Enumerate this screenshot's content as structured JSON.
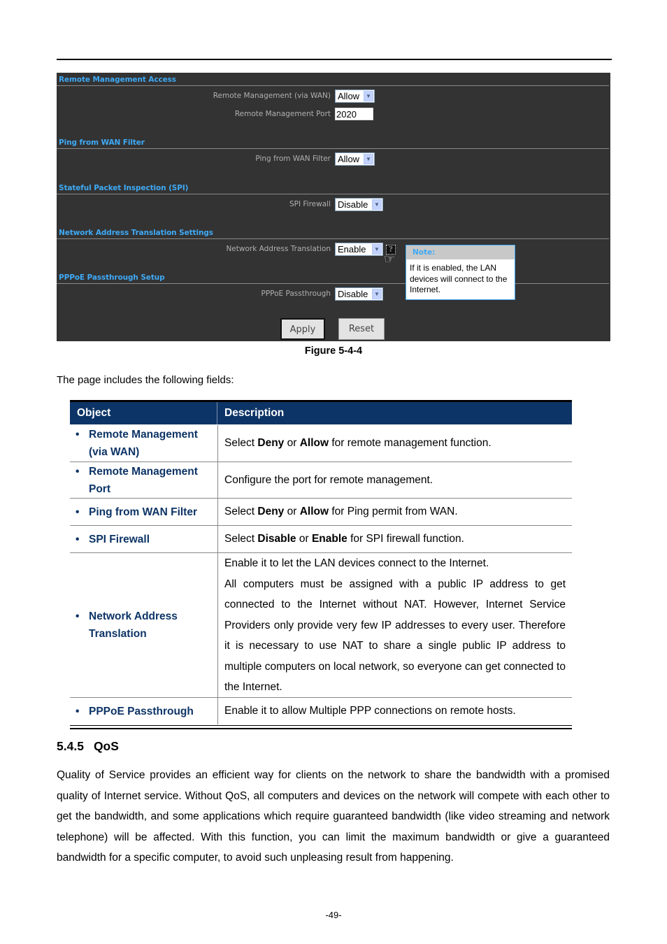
{
  "figure": {
    "sections": [
      {
        "title": "Remote Management Access"
      },
      {
        "title": "Ping from WAN Filter"
      },
      {
        "title": "Stateful Packet Inspection (SPI)"
      },
      {
        "title": "Network Address Translation Settings"
      },
      {
        "title": "PPPoE Passthrough Setup"
      }
    ],
    "fields": {
      "remote_mgmt": {
        "label": "Remote Management (via WAN)",
        "value": "Allow"
      },
      "remote_port": {
        "label": "Remote Management Port",
        "value": "2020"
      },
      "ping_filter": {
        "label": "Ping from WAN Filter",
        "value": "Allow"
      },
      "spi": {
        "label": "SPI Firewall",
        "value": "Disable"
      },
      "nat": {
        "label": "Network Address Translation",
        "value": "Enable"
      },
      "pppoe": {
        "label": "PPPoE Passthrough",
        "value": "Disable"
      }
    },
    "help_icon": "?",
    "note": {
      "title": "Note:",
      "body": "If it is enabled, the LAN devices will connect to the Internet."
    },
    "buttons": {
      "apply": "Apply",
      "reset": "Reset"
    },
    "caption": "Figure 5-4-4"
  },
  "intro": "The page includes the following fields:",
  "table": {
    "headers": [
      "Object",
      "Description"
    ],
    "rows": [
      {
        "object": "Remote Management (via WAN)",
        "pre": "Select ",
        "b1": "Deny",
        "mid": " or ",
        "b2": "Allow",
        "post": " for remote management function."
      },
      {
        "object": "Remote Management Port",
        "desc": "Configure the port for remote management."
      },
      {
        "object": "Ping from WAN Filter",
        "pre": "Select ",
        "b1": "Deny",
        "mid": " or ",
        "b2": "Allow",
        "post": " for Ping permit from WAN."
      },
      {
        "object": "SPI Firewall",
        "pre": "Select ",
        "b1": "Disable",
        "mid": " or ",
        "b2": "Enable",
        "post": " for SPI firewall function."
      },
      {
        "object": "Network Address Translation",
        "desc1": "Enable it to let the LAN devices connect to the Internet.",
        "desc2": "All computers must be assigned with a public IP address to get connected to the Internet without NAT. However, Internet Service Providers only provide very few IP addresses to every user. Therefore it is necessary to use NAT to share a single public IP address to multiple computers on local network, so everyone can get connected to the Internet."
      },
      {
        "object": "PPPoE Passthrough",
        "desc": "Enable it to allow Multiple PPP connections on remote hosts."
      }
    ]
  },
  "section": {
    "number": "5.4.5",
    "title": "QoS",
    "body": "Quality of Service provides an efficient way for clients on the network to share the bandwidth with a promised quality of Internet service. Without QoS, all computers and devices on the network will compete with each other to get the bandwidth, and some applications which require guaranteed bandwidth (like video streaming and network telephone) will be affected. With this function, you can limit the maximum bandwidth or give a guaranteed bandwidth for a specific computer, to avoid such unpleasing result from happening."
  },
  "page_number": "-49-"
}
